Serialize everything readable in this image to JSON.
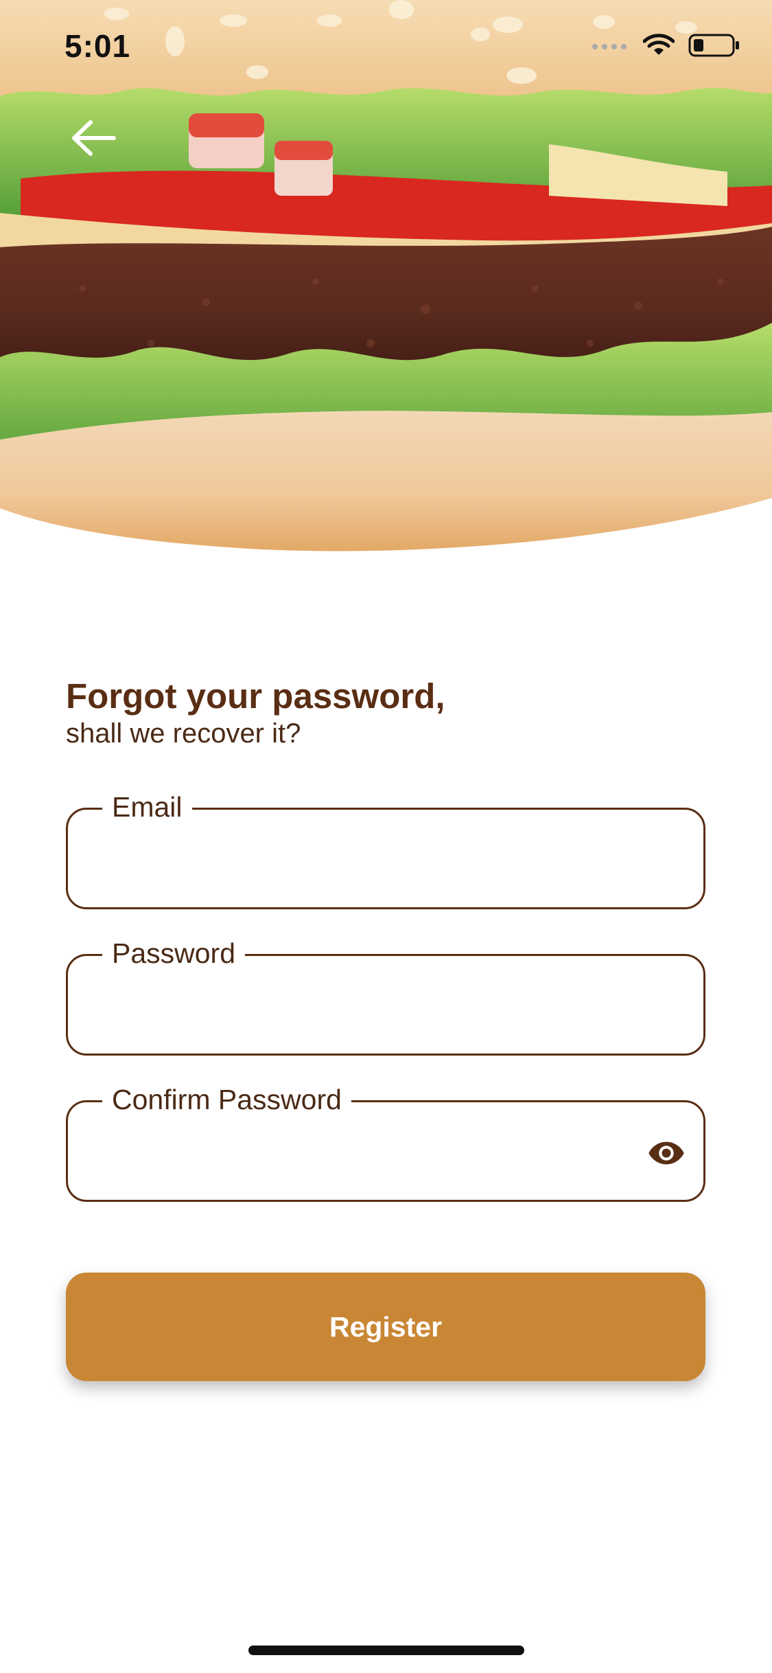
{
  "status_bar": {
    "time": "5:01"
  },
  "icons": {
    "back": "arrow-left-icon",
    "signal": "signal-icon",
    "wifi": "wifi-icon",
    "battery": "battery-icon",
    "eye": "eye-icon"
  },
  "header": {
    "title": "Forgot your password,",
    "subtitle": "shall we recover it?"
  },
  "form": {
    "email": {
      "label": "Email",
      "value": ""
    },
    "password": {
      "label": "Password",
      "value": ""
    },
    "confirm_password": {
      "label": "Confirm Password",
      "value": ""
    },
    "submit_label": "Register"
  },
  "colors": {
    "primary_brown": "#5a2e14",
    "button": "#c98634",
    "background": "#ffffff"
  }
}
